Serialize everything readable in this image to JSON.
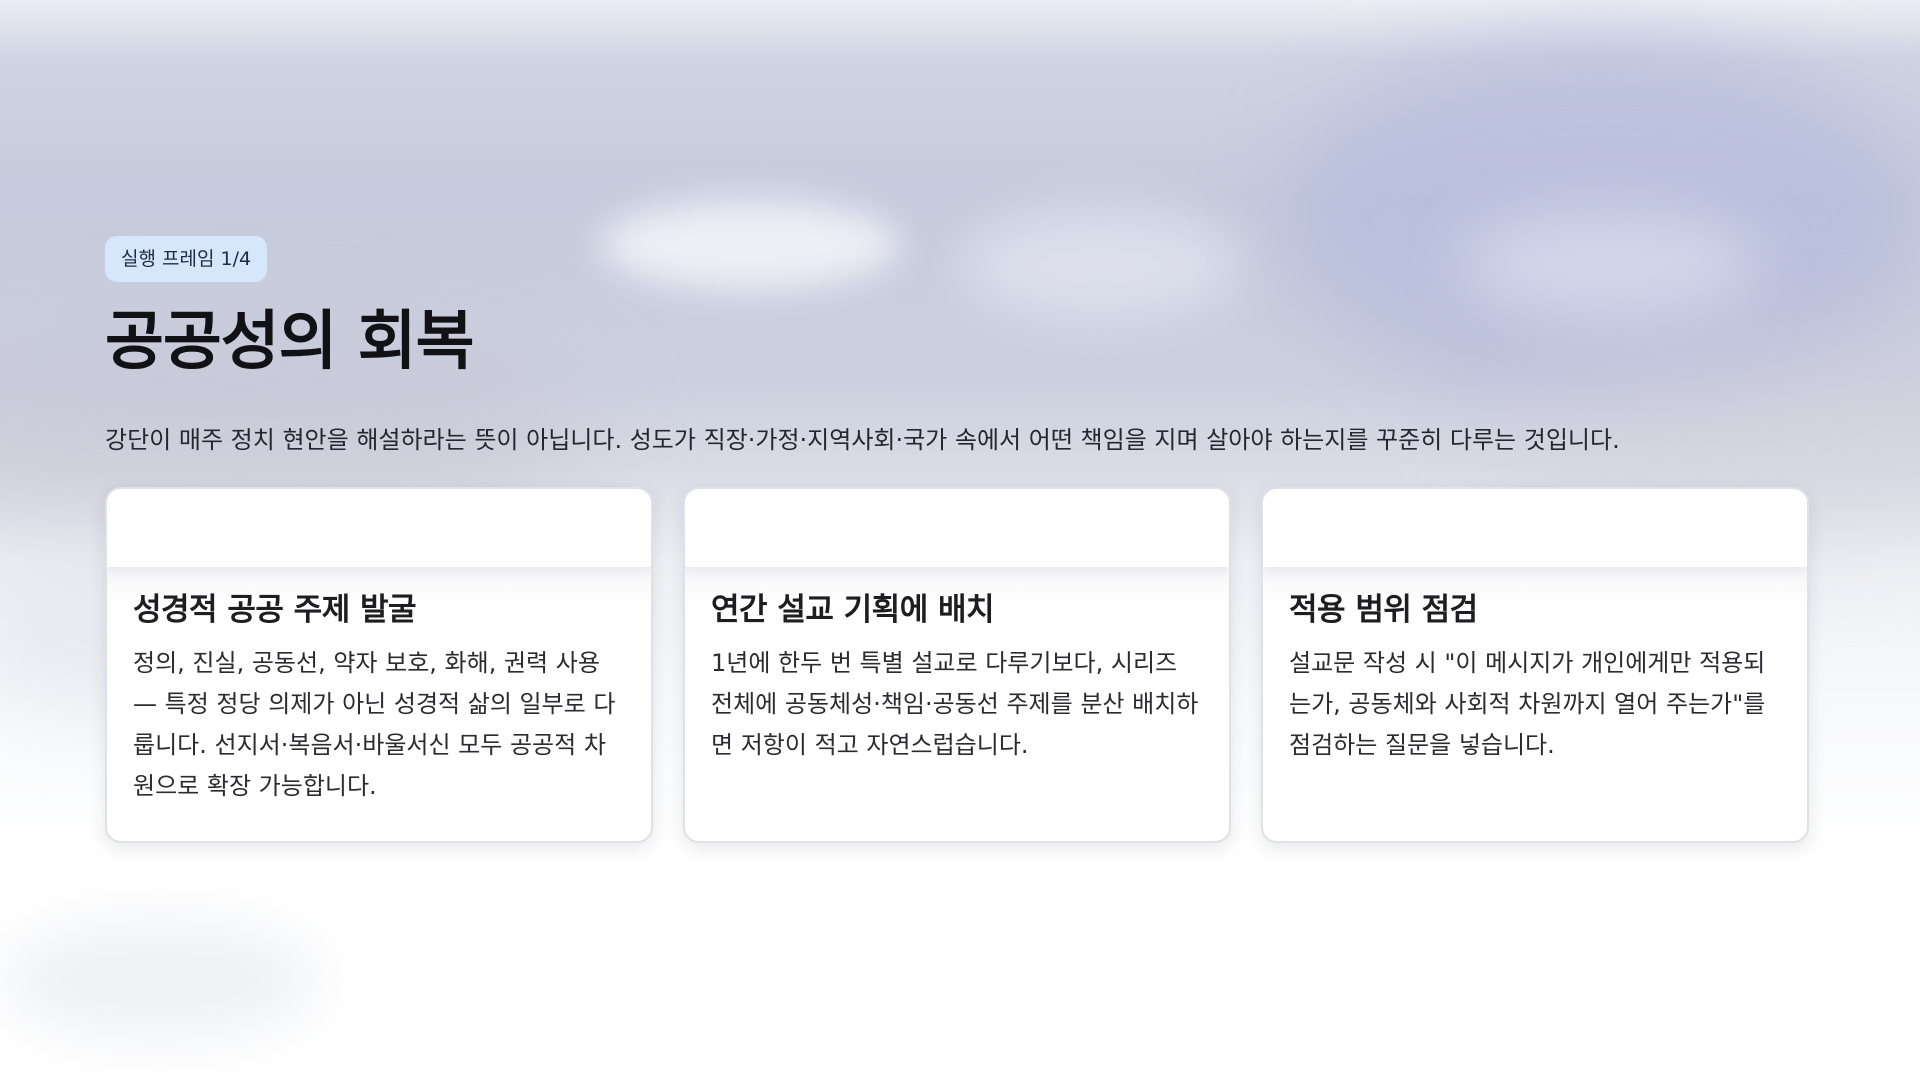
{
  "slide": {
    "badge": "실행 프레임 1/4",
    "title": "공공성의 회복",
    "subtitle": "강단이 매주 정치 현안을 해설하라는 뜻이 아닙니다. 성도가 직장·가정·지역사회·국가 속에서 어떤 책임을 지며 살아야 하는지를 꾸준히 다루는 것입니다."
  },
  "cards": [
    {
      "title": "성경적 공공 주제 발굴",
      "text": "정의, 진실, 공동선, 약자 보호, 화해, 권력 사용 — 특정 정당 의제가 아닌 성경적 삶의 일부로 다룹니다. 선지서·복음서·바울서신 모두 공공적 차원으로 확장 가능합니다."
    },
    {
      "title": "연간 설교 기획에 배치",
      "text": "1년에 한두 번 특별 설교로 다루기보다, 시리즈 전체에 공동체성·책임·공동선 주제를 분산 배치하면 저항이 적고 자연스럽습니다."
    },
    {
      "title": "적용 범위 점검",
      "text": "설교문 작성 시 \"이 메시지가 개인에게만 적용되는가, 공동체와 사회적 차원까지 열어 주는가\"를 점검하는 질문을 넣습니다."
    }
  ]
}
